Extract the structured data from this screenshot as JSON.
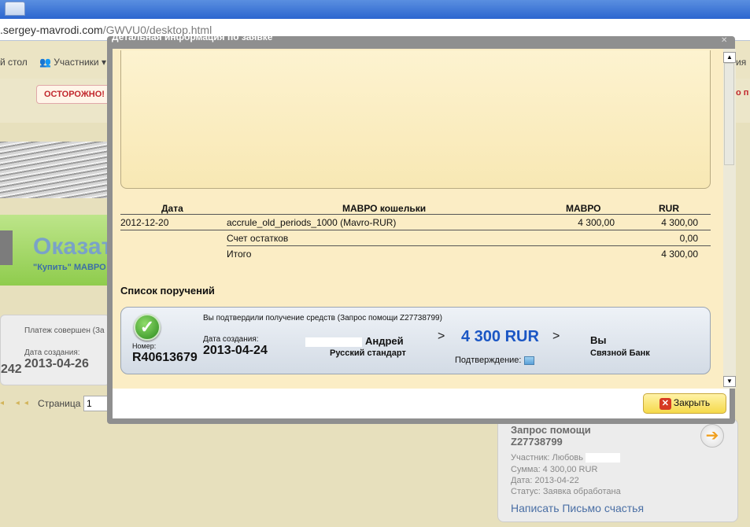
{
  "browser": {
    "url_domain": ".sergey-mavrodi.com",
    "url_path": "/GWVU0/desktop.html"
  },
  "background_page": {
    "nav": {
      "desk": "й стол",
      "members": "Участники",
      "right_fragment": "ия"
    },
    "warning": {
      "label": "ОСТОРОЖНО!",
      "right_fragment": "о п"
    },
    "banner": {
      "title": "Оказат",
      "subtitle": "\"Купить\" МАВРО"
    },
    "left_card": {
      "status": "Платеж совершен (За",
      "date_label": "Дата создания:",
      "date": "2013-04-26",
      "number_fragment": "242"
    },
    "pager": {
      "label": "Страница",
      "value": "1"
    },
    "help_card": {
      "title": "Запрос помощи",
      "id": "Z27738799",
      "member": "Участник: Любовь",
      "sum": "Сумма: 4 300,00 RUR",
      "date": "Дата: 2013-04-22",
      "status": "Статус: Заявка обработана",
      "link": "Написать Письмо счастья"
    }
  },
  "modal": {
    "title": "Детальная информация по заявке",
    "table": {
      "headers": [
        "Дата",
        "МАВРО кошельки",
        "МАВРО",
        "RUR"
      ],
      "rows": [
        {
          "date": "2012-12-20",
          "wallet": "accrule_old_periods_1000 (Mavro-RUR)",
          "mavro": "4 300,00",
          "rur": "4 300,00"
        },
        {
          "date": "",
          "wallet": "Счет остатков",
          "mavro": "",
          "rur": "0,00"
        },
        {
          "date": "",
          "wallet": "Итого",
          "mavro": "",
          "rur": "4 300,00"
        }
      ]
    },
    "orders_title": "Список поручений",
    "order": {
      "message": "Вы подтвердили получение средств (Запрос помощи Z27738799)",
      "number_label": "Номер:",
      "number": "R40613679",
      "created_label": "Дата создания:",
      "created": "2013-04-24",
      "sender_name": "Андрей",
      "sender_plan": "Русский стандарт",
      "amount": "4 300 RUR",
      "confirm_label": "Подтверждение:",
      "recipient": "Вы",
      "recipient_bank": "Связной Банк",
      "arrow": ">"
    },
    "close_button": "Закрыть"
  },
  "colors": {
    "amount": "#1a56c4",
    "warning": "#c1272d",
    "content_bg": "#fbedc5"
  }
}
